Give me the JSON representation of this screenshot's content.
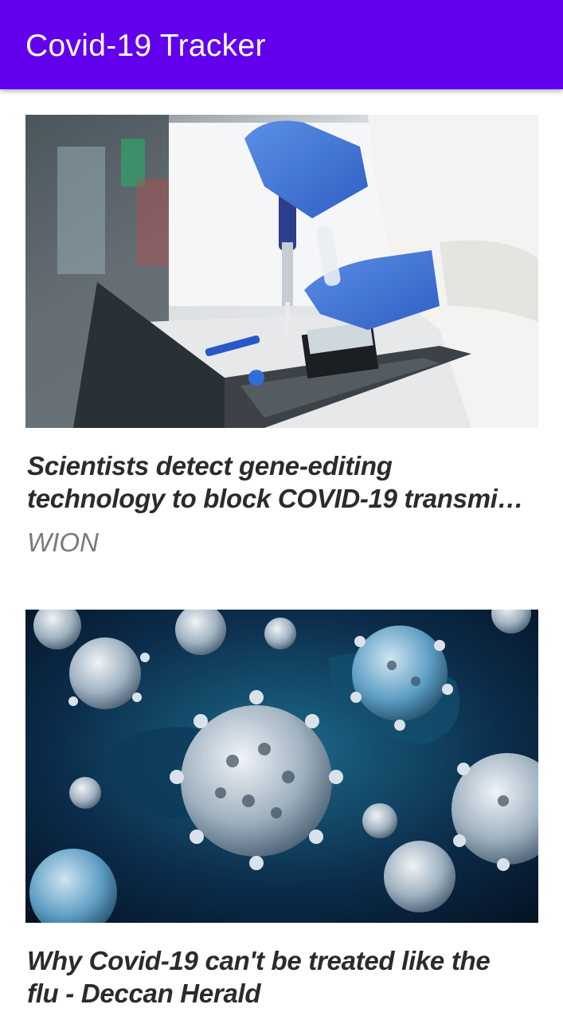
{
  "app_bar": {
    "title": "Covid-19 Tracker",
    "background_color": "#6200ee"
  },
  "news": [
    {
      "image": "lab-scientist-pipette-photo",
      "headline_line1": "Scientists detect gene-editing",
      "headline_line2": "technology to block COVID-19 transmi…",
      "source": "WION"
    },
    {
      "image": "coronavirus-particles-photo",
      "headline_line1": "Why Covid-19 can't be treated like the",
      "headline_line2": "flu - Deccan Herald",
      "source": ""
    }
  ]
}
